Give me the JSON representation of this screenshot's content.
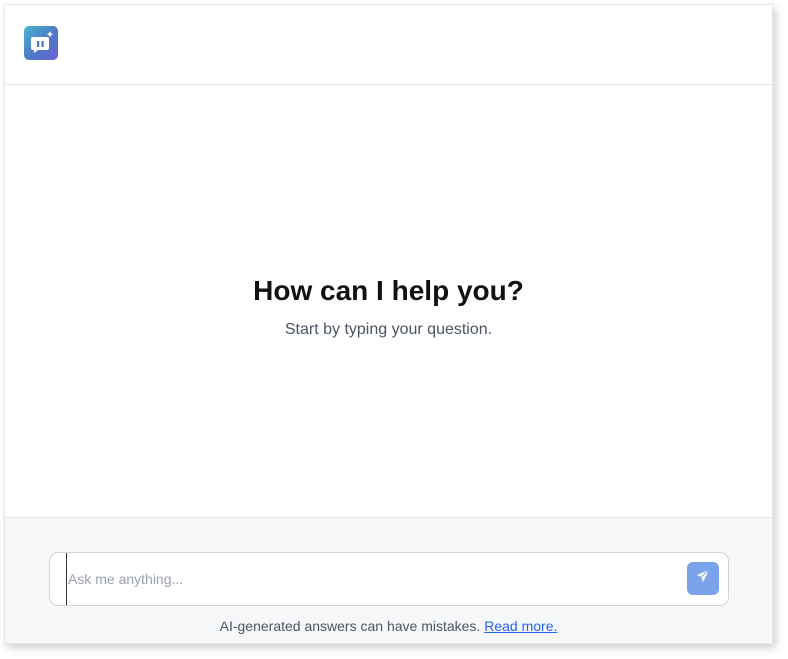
{
  "header": {
    "logo_icon": "chat-bubble-icon",
    "logo_colors": [
      "#44b7c9",
      "#4f78c8",
      "#6a5fd0"
    ]
  },
  "main": {
    "headline": "How can I help you?",
    "subtext": "Start by typing your question."
  },
  "composer": {
    "placeholder": "Ask me anything...",
    "value": "",
    "send_icon": "paper-plane-icon",
    "send_color": "#7ba3ea"
  },
  "footer": {
    "disclaimer": "AI-generated answers can have mistakes.",
    "link_label": "Read more."
  }
}
